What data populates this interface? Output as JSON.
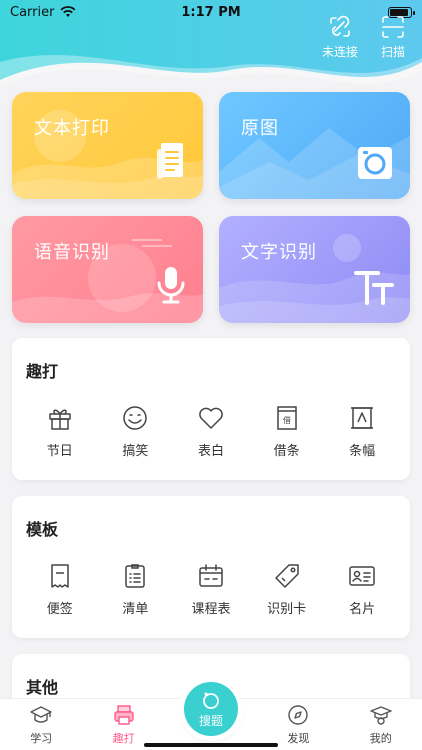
{
  "status_bar": {
    "carrier": "Carrier",
    "time": "1:17 PM",
    "battery_level": 0.95
  },
  "header": {
    "actions": [
      {
        "label": "未连接",
        "icon": "disconnected-icon"
      },
      {
        "label": "扫描",
        "icon": "scan-icon"
      }
    ]
  },
  "feature_cards": [
    {
      "label": "文本打印",
      "icon": "document-icon",
      "color": "#ffcd47"
    },
    {
      "label": "原图",
      "icon": "camera-icon",
      "color": "#5cb6fa"
    },
    {
      "label": "语音识别",
      "icon": "microphone-icon",
      "color": "#ff8d99"
    },
    {
      "label": "文字识别",
      "icon": "text-recognition-icon",
      "color": "#9e9bf8"
    }
  ],
  "sections": {
    "fun": {
      "title": "趣打",
      "items": [
        {
          "label": "节日",
          "icon": "gift-icon"
        },
        {
          "label": "搞笑",
          "icon": "smile-icon"
        },
        {
          "label": "表白",
          "icon": "heart-icon"
        },
        {
          "label": "借条",
          "icon": "iou-icon"
        },
        {
          "label": "条幅",
          "icon": "banner-icon"
        }
      ]
    },
    "templates": {
      "title": "模板",
      "items": [
        {
          "label": "便签",
          "icon": "note-icon"
        },
        {
          "label": "清单",
          "icon": "checklist-icon"
        },
        {
          "label": "课程表",
          "icon": "schedule-icon"
        },
        {
          "label": "识别卡",
          "icon": "tag-icon"
        },
        {
          "label": "名片",
          "icon": "business-card-icon"
        }
      ]
    },
    "other": {
      "title": "其他"
    }
  },
  "tabbar": {
    "tabs": [
      {
        "label": "学习",
        "icon": "graduation-cap-icon",
        "active": false
      },
      {
        "label": "趣打",
        "icon": "printer-icon",
        "active": true
      },
      {
        "label": "发现",
        "icon": "compass-icon",
        "active": false
      },
      {
        "label": "我的",
        "icon": "profile-icon",
        "active": false
      }
    ],
    "center": {
      "label": "搜题",
      "icon": "search-question-icon"
    }
  },
  "colors": {
    "header": "#4fd3d9",
    "accent": "#ff5b8b",
    "center_button": "#3ad0cf"
  }
}
